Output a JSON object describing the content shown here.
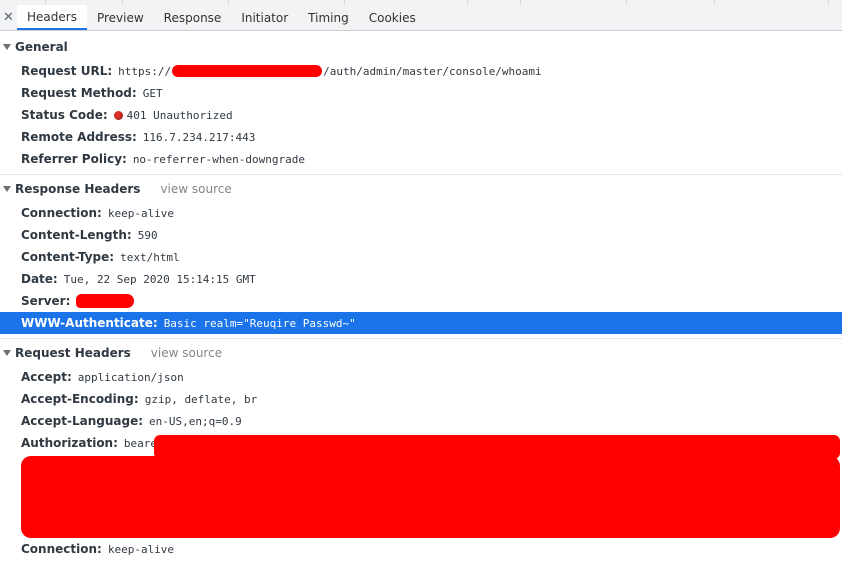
{
  "tabs": {
    "close_icon": "close-icon",
    "items": [
      "Headers",
      "Preview",
      "Response",
      "Initiator",
      "Timing",
      "Cookies"
    ],
    "active": "Headers"
  },
  "general": {
    "title": "General",
    "request_url_key": "Request URL:",
    "request_url_prefix": "https://",
    "request_url_suffix": "/auth/admin/master/console/whoami",
    "request_method_key": "Request Method:",
    "request_method_value": "GET",
    "status_code_key": "Status Code:",
    "status_code_value": "401 Unauthorized",
    "remote_address_key": "Remote Address:",
    "remote_address_value": "116.7.234.217:443",
    "referrer_policy_key": "Referrer Policy:",
    "referrer_policy_value": "no-referrer-when-downgrade"
  },
  "response_headers": {
    "title": "Response Headers",
    "view_source": "view source",
    "rows": [
      {
        "key": "Connection:",
        "value": "keep-alive"
      },
      {
        "key": "Content-Length:",
        "value": "590"
      },
      {
        "key": "Content-Type:",
        "value": "text/html"
      },
      {
        "key": "Date:",
        "value": "Tue, 22 Sep 2020 15:14:15 GMT"
      },
      {
        "key": "Server:",
        "value": ""
      },
      {
        "key": "WWW-Authenticate:",
        "value": "Basic realm=\"Reuqire Passwd~\""
      }
    ]
  },
  "request_headers": {
    "title": "Request Headers",
    "view_source": "view source",
    "rows": [
      {
        "key": "Accept:",
        "value": "application/json"
      },
      {
        "key": "Accept-Encoding:",
        "value": "gzip, deflate, br"
      },
      {
        "key": "Accept-Language:",
        "value": "en-US,en;q=0.9"
      },
      {
        "key": "Authorization:",
        "value": "bearer"
      },
      {
        "key": "Connection:",
        "value": "keep-alive"
      }
    ]
  },
  "colors": {
    "selected_row": "#1a73e8",
    "redaction": "#ff0000",
    "status_dot": "#d93025"
  }
}
